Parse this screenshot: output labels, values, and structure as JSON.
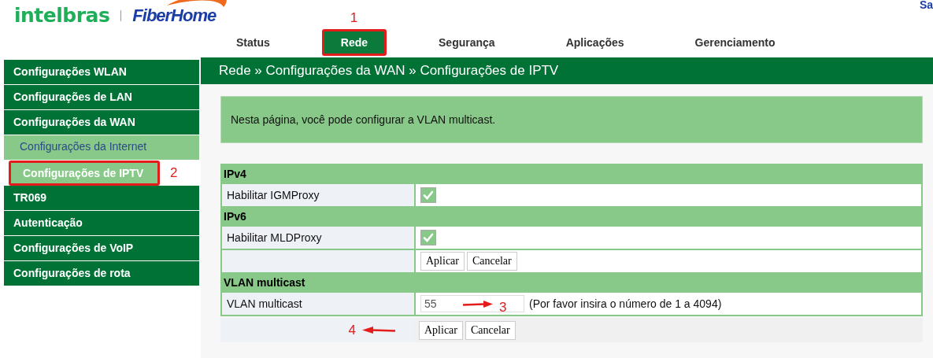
{
  "logo": {
    "brand": "intelbras",
    "partner": "FiberHome"
  },
  "top_link": "Sa",
  "tabs": [
    {
      "label": "Status",
      "selected": false,
      "highlighted": false
    },
    {
      "label": "Rede",
      "selected": true,
      "highlighted": true,
      "annotation": "1"
    },
    {
      "label": "Segurança",
      "selected": false,
      "highlighted": false
    },
    {
      "label": "Aplicações",
      "selected": false,
      "highlighted": false
    },
    {
      "label": "Gerenciamento",
      "selected": false,
      "highlighted": false
    }
  ],
  "sidebar": {
    "items": [
      {
        "label": "Configurações WLAN"
      },
      {
        "label": "Configurações de LAN"
      },
      {
        "label": "Configurações da WAN",
        "children": [
          {
            "label": "Configurações da Internet",
            "selected": false,
            "highlighted": false
          },
          {
            "label": "Configurações de IPTV",
            "selected": true,
            "highlighted": true,
            "annotation": "2"
          }
        ]
      },
      {
        "label": "TR069"
      },
      {
        "label": "Autenticação"
      },
      {
        "label": "Configurações de VoIP"
      },
      {
        "label": "Configurações de rota"
      }
    ]
  },
  "breadcrumb": "Rede » Configurações da WAN » Configurações de IPTV",
  "intro": "Nesta página, você pode configurar a VLAN multicast.",
  "sections": [
    {
      "title": "IPv4",
      "rows": [
        {
          "kind": "checkbox",
          "label": "Habilitar IGMProxy",
          "checked": true
        }
      ]
    },
    {
      "title": "IPv6",
      "rows": [
        {
          "kind": "checkbox",
          "label": "Habilitar MLDProxy",
          "checked": true
        },
        {
          "kind": "buttons",
          "buttons": [
            "Aplicar",
            "Cancelar"
          ]
        }
      ]
    },
    {
      "title": "VLAN multicast",
      "rows": [
        {
          "kind": "input",
          "label": "VLAN multicast",
          "value": "55",
          "hint": "(Por favor insira o número de 1 a 4094)",
          "annotation": "3"
        }
      ]
    }
  ],
  "footer": {
    "buttons": [
      "Aplicar",
      "Cancelar"
    ],
    "annotation": "4"
  }
}
